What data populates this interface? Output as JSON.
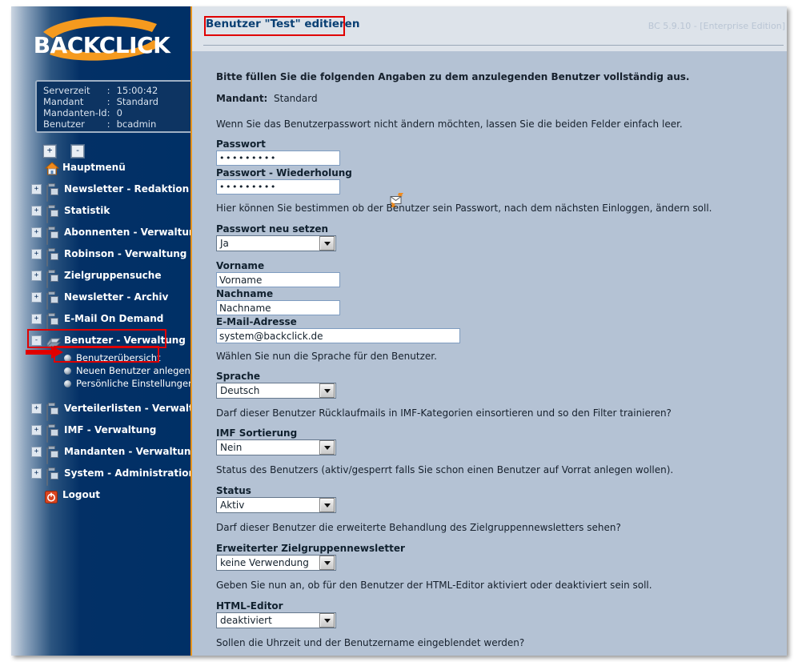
{
  "app": {
    "logo_text": "BACKCLICK",
    "version": "BC 5.9.10 - [Enterprise Edition]"
  },
  "infobox": {
    "rows": [
      {
        "key": "Serverzeit",
        "sep": ":",
        "value": "15:00:42"
      },
      {
        "key": "Mandant",
        "sep": ":",
        "value": "Standard"
      },
      {
        "key": "Mandanten-Id",
        "sep": ":",
        "value": "0"
      },
      {
        "key": "Benutzer",
        "sep": ":",
        "value": "bcadmin"
      }
    ]
  },
  "tree_controls": {
    "expand_all": "+",
    "collapse_all": "-"
  },
  "sidebar": {
    "items": [
      {
        "label": "Hauptmenü",
        "icon": "house-icon",
        "expander": "",
        "type": "home"
      },
      {
        "label": "Newsletter - Redaktion",
        "icon": "folder-icon",
        "expander": "+",
        "type": "folder"
      },
      {
        "label": "Statistik",
        "icon": "folder-icon",
        "expander": "+",
        "type": "folder"
      },
      {
        "label": "Abonnenten - Verwaltung",
        "icon": "folder-icon",
        "expander": "+",
        "type": "folder"
      },
      {
        "label": "Robinson - Verwaltung",
        "icon": "folder-icon",
        "expander": "+",
        "type": "folder"
      },
      {
        "label": "Zielgruppensuche",
        "icon": "folder-icon",
        "expander": "+",
        "type": "folder"
      },
      {
        "label": "Newsletter - Archiv",
        "icon": "folder-icon",
        "expander": "+",
        "type": "folder"
      },
      {
        "label": "E-Mail On Demand",
        "icon": "folder-icon",
        "expander": "+",
        "type": "folder"
      },
      {
        "label": "Benutzer - Verwaltung",
        "icon": "users-icon",
        "expander": "-",
        "type": "folder-open"
      }
    ],
    "subitems": [
      {
        "label": "Benutzerübersicht"
      },
      {
        "label": "Neuen Benutzer anlegen"
      },
      {
        "label": "Persönliche Einstellungen"
      }
    ],
    "items2": [
      {
        "label": "Verteilerlisten - Verwaltung",
        "icon": "folder-icon",
        "expander": "+",
        "type": "folder"
      },
      {
        "label": "IMF - Verwaltung",
        "icon": "folder-icon",
        "expander": "+",
        "type": "folder"
      },
      {
        "label": "Mandanten - Verwaltung",
        "icon": "folder-icon",
        "expander": "+",
        "type": "folder"
      },
      {
        "label": "System - Administration",
        "icon": "folder-icon",
        "expander": "+",
        "type": "folder"
      },
      {
        "label": "Logout",
        "icon": "power-icon",
        "expander": "",
        "type": "logout"
      }
    ]
  },
  "header": {
    "title": "Benutzer \"Test\" editieren"
  },
  "form": {
    "intro": "Bitte füllen Sie die folgenden Angaben zu dem anzulegenden Benutzer vollständig aus.",
    "mandant_label": "Mandant:",
    "mandant_value": "Standard",
    "hint_password": "Wenn Sie das Benutzerpasswort nicht ändern möchten, lassen Sie die beiden Felder einfach leer.",
    "password_label": "Passwort",
    "password_value": "•••••••••",
    "password_repeat_label": "Passwort - Wiederholung",
    "password_repeat_value": "•••••••••",
    "mail_icon": "send-mail-icon",
    "hint_newpass": "Hier können Sie bestimmen ob der Benutzer sein Passwort, nach dem nächsten Einloggen, ändern soll.",
    "newpass_label": "Passwort neu setzen",
    "newpass_value": "Ja",
    "firstname_label": "Vorname",
    "firstname_value": "Vorname",
    "lastname_label": "Nachname",
    "lastname_value": "Nachname",
    "email_label": "E-Mail-Adresse",
    "email_value": "system@backclick.de",
    "hint_language": "Wählen Sie nun die Sprache für den Benutzer.",
    "language_label": "Sprache",
    "language_value": "Deutsch",
    "hint_imf": "Darf dieser Benutzer Rücklaufmails in IMF-Kategorien einsortieren und so den Filter trainieren?",
    "imf_label": "IMF Sortierung",
    "imf_value": "Nein",
    "hint_status": "Status des Benutzers (aktiv/gesperrt falls Sie schon einen Benutzer auf Vorrat anlegen wollen).",
    "status_label": "Status",
    "status_value": "Aktiv",
    "hint_zgn": "Darf dieser Benutzer die erweiterte Behandlung des Zielgruppennewsletters sehen?",
    "zgn_label": "Erweiterter Zielgruppennewsletter",
    "zgn_value": "keine Verwendung",
    "hint_html": "Geben Sie nun an, ob für den Benutzer der HTML-Editor aktiviert oder deaktiviert sein soll.",
    "html_label": "HTML-Editor",
    "html_value": "deaktiviert",
    "hint_time": "Sollen die Uhrzeit und der Benutzername eingeblendet werden?"
  },
  "annotations": {
    "arrow": "red-arrow-pointer",
    "highlight_color": "#e00000"
  }
}
